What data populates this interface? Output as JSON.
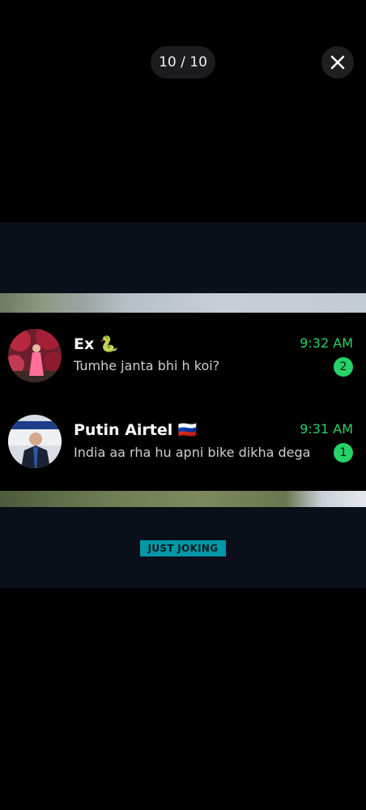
{
  "viewer": {
    "counter": "10 / 10",
    "close_icon": "close-icon"
  },
  "chats": [
    {
      "name": "Ex",
      "emoji": "🐍",
      "preview": "Tumhe janta bhi h koi?",
      "time": "9:32 AM",
      "unread": "2"
    },
    {
      "name": "Putin Airtel",
      "emoji": "🇷🇺",
      "preview": "India aa rha hu apni bike dikha dega",
      "time": "9:31 AM",
      "unread": "1"
    }
  ],
  "caption": "JUST JOKING",
  "colors": {
    "accent_green": "#25d366",
    "caption_bg": "#0097a7",
    "media_bg": "#0b0f1a"
  }
}
